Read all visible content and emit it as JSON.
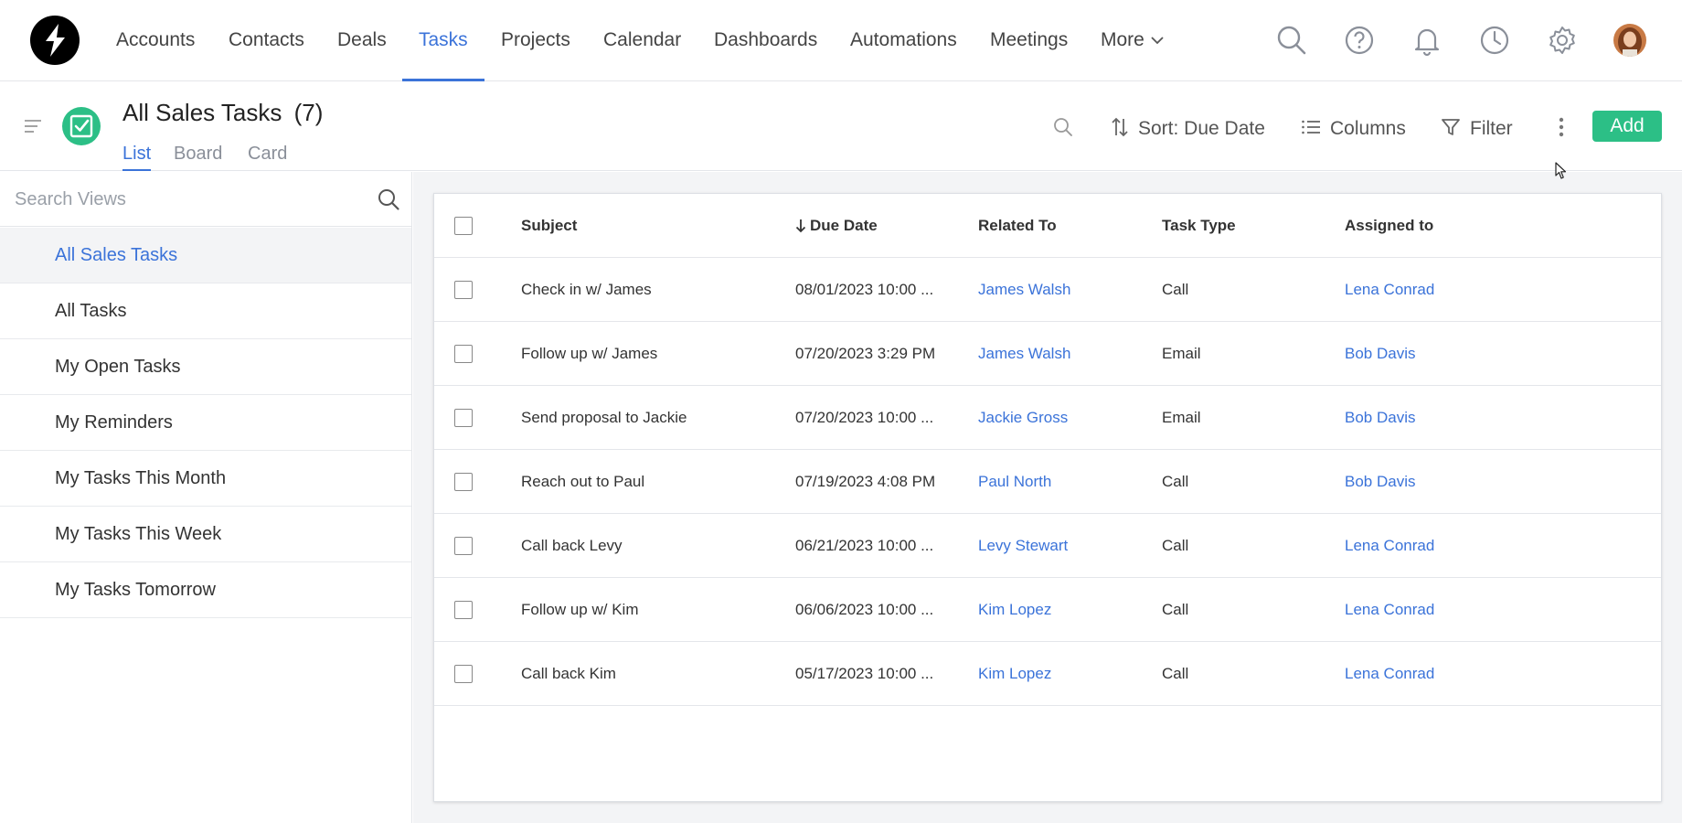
{
  "nav": {
    "items": [
      {
        "label": "Accounts",
        "active": false
      },
      {
        "label": "Contacts",
        "active": false
      },
      {
        "label": "Deals",
        "active": false
      },
      {
        "label": "Tasks",
        "active": true
      },
      {
        "label": "Projects",
        "active": false
      },
      {
        "label": "Calendar",
        "active": false
      },
      {
        "label": "Dashboards",
        "active": false
      },
      {
        "label": "Automations",
        "active": false
      },
      {
        "label": "Meetings",
        "active": false
      }
    ],
    "more_label": "More",
    "icons": [
      "search-icon",
      "help-icon",
      "bell-icon",
      "clock-icon",
      "gear-icon"
    ]
  },
  "header": {
    "title": "All Sales Tasks",
    "count": "(7)",
    "tabs": [
      "List",
      "Board",
      "Card"
    ],
    "active_tab": "List",
    "sort_label": "Sort: Due Date",
    "columns_label": "Columns",
    "filter_label": "Filter",
    "add_label": "Add"
  },
  "sidebar": {
    "search_placeholder": "Search Views",
    "items": [
      {
        "label": "All Sales Tasks",
        "active": true
      },
      {
        "label": "All Tasks",
        "active": false
      },
      {
        "label": "My Open Tasks",
        "active": false
      },
      {
        "label": "My Reminders",
        "active": false
      },
      {
        "label": "My Tasks This Month",
        "active": false
      },
      {
        "label": "My Tasks This Week",
        "active": false
      },
      {
        "label": "My Tasks Tomorrow",
        "active": false
      }
    ]
  },
  "table": {
    "columns": [
      "Subject",
      "Due Date",
      "Related To",
      "Task Type",
      "Assigned to"
    ],
    "rows": [
      {
        "subject": "Check in w/ James",
        "due": "08/01/2023 10:00 ...",
        "related": "James Walsh",
        "type": "Call",
        "assigned": "Lena Conrad"
      },
      {
        "subject": "Follow up w/ James",
        "due": "07/20/2023 3:29 PM",
        "related": "James Walsh",
        "type": "Email",
        "assigned": "Bob Davis"
      },
      {
        "subject": "Send proposal to Jackie",
        "due": "07/20/2023 10:00 ...",
        "related": "Jackie Gross",
        "type": "Email",
        "assigned": "Bob Davis"
      },
      {
        "subject": "Reach out to Paul",
        "due": "07/19/2023 4:08 PM",
        "related": "Paul North",
        "type": "Call",
        "assigned": "Bob Davis"
      },
      {
        "subject": "Call back Levy",
        "due": "06/21/2023 10:00 ...",
        "related": "Levy Stewart",
        "type": "Call",
        "assigned": "Lena Conrad"
      },
      {
        "subject": "Follow up w/ Kim",
        "due": "06/06/2023 10:00 ...",
        "related": "Kim Lopez",
        "type": "Call",
        "assigned": "Lena Conrad"
      },
      {
        "subject": "Call back Kim",
        "due": "05/17/2023 10:00 ...",
        "related": "Kim Lopez",
        "type": "Call",
        "assigned": "Lena Conrad"
      }
    ]
  },
  "colors": {
    "accent": "#3b73d9",
    "brand_green": "#2cbf86",
    "muted": "#8a8f99"
  }
}
